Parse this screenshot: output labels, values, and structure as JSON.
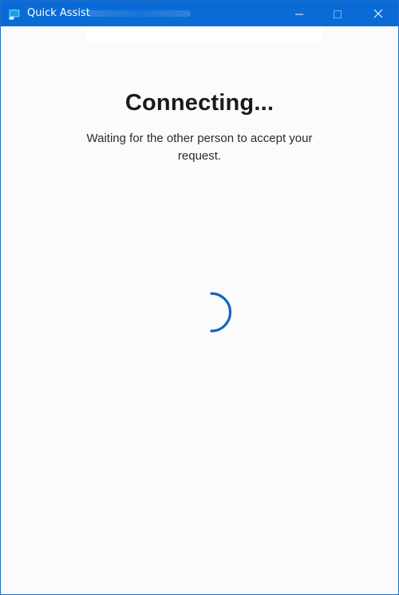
{
  "window": {
    "title": "Quick Assist",
    "accent_color": "#0a6bd6"
  },
  "titlebar_buttons": {
    "minimize": "minimize-icon",
    "maximize": "maximize-icon",
    "close": "close-icon"
  },
  "main": {
    "heading": "Connecting...",
    "message": "Waiting for the other person to accept your request.",
    "spinner_icon": "loading-spinner-icon",
    "spinner_color": "#1365c0"
  }
}
